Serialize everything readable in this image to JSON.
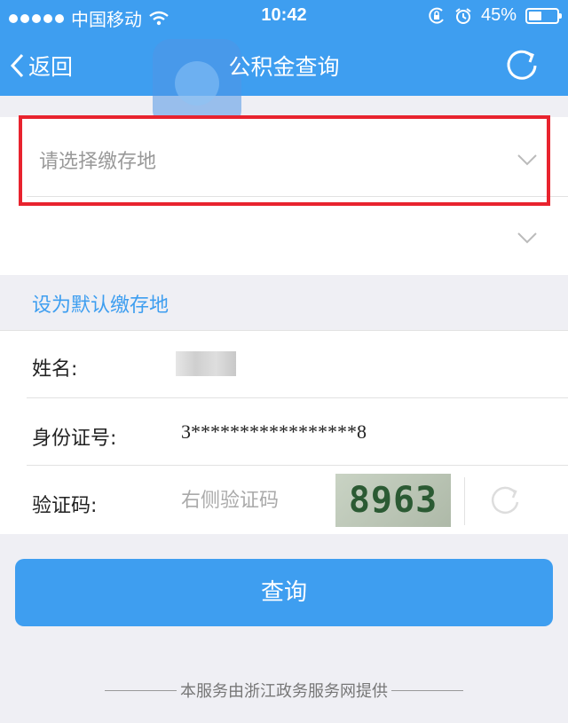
{
  "status_bar": {
    "carrier": "中国移动",
    "time": "10:42",
    "battery": "45%",
    "battery_level": 0.45,
    "icons": [
      "signal-dots-icon",
      "wifi-icon",
      "orientation-lock-icon",
      "alarm-icon",
      "battery-icon"
    ]
  },
  "nav": {
    "back_label": "返回",
    "title": "公积金查询",
    "refresh_icon": "refresh-icon"
  },
  "location": {
    "select_placeholder": "请选择缴存地",
    "second_select_placeholder": "",
    "set_default_link": "设为默认缴存地"
  },
  "form": {
    "name_label": "姓名:",
    "name_value": "",
    "id_label": "身份证号:",
    "id_value": "3*****************8",
    "captcha_label": "验证码:",
    "captcha_placeholder": "右侧验证码",
    "captcha_image_text": "8963"
  },
  "submit_label": "查询",
  "footer": "本服务由浙江政务服务网提供",
  "colors": {
    "accent": "#3e9ef0",
    "highlight_box": "#e8232e",
    "background": "#efeff4"
  }
}
